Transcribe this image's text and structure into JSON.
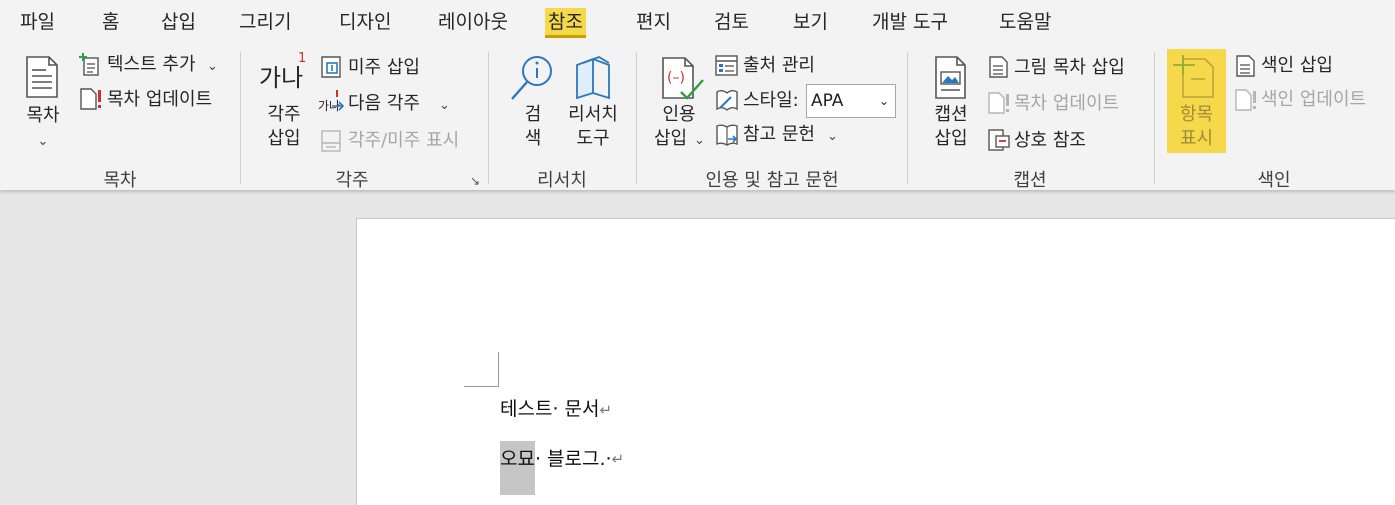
{
  "menu_tabs": [
    "파일",
    "홈",
    "삽입",
    "그리기",
    "디자인",
    "레이아웃",
    "참조",
    "편지",
    "검토",
    "보기",
    "개발 도구",
    "도움말"
  ],
  "active_tab": "참조",
  "groups": {
    "toc": {
      "label": "목차",
      "big_button": "목차",
      "add_text": "텍스트 추가",
      "update_toc": "목차 업데이트"
    },
    "footnotes": {
      "label": "각주",
      "big_button_line1": "각주",
      "big_button_line2": "삽입",
      "big_icon_text": "가나",
      "superscript": "1",
      "insert_endnote": "미주 삽입",
      "next_footnote": "다음 각주",
      "next_icon_text": "가나",
      "show_notes": "각주/미주 표시"
    },
    "research": {
      "label": "리서치",
      "search_line1": "검",
      "search_line2": "색",
      "researcher_line1": "리서치",
      "researcher_line2": "도구"
    },
    "citations": {
      "label": "인용 및 참고 문헌",
      "insert_line1": "인용",
      "insert_line2": "삽입",
      "manage_sources": "출처 관리",
      "style_label": "스타일:",
      "style_value": "APA",
      "bibliography": "참고 문헌"
    },
    "captions": {
      "label": "캡션",
      "insert_line1": "캡션",
      "insert_line2": "삽입",
      "insert_tof": "그림 목차 삽입",
      "update_table": "목차 업데이트",
      "cross_ref": "상호 참조"
    },
    "index": {
      "label": "색인",
      "mark_line1": "항목",
      "mark_line2": "표시",
      "insert_index": "색인 삽입",
      "update_index": "색인 업데이트"
    }
  },
  "document": {
    "line1": "테스트· 문서",
    "line2_selected": "오묘",
    "line2_rest": "· 블로그.·",
    "para_mark": "↵"
  },
  "colors": {
    "accent": "#f5d94a",
    "ribbon_bg": "#f3f3f3",
    "workspace_bg": "#e6e6e6",
    "icon_blue": "#2b78c2",
    "icon_red": "#d0312d",
    "icon_green": "#2f9e44"
  }
}
